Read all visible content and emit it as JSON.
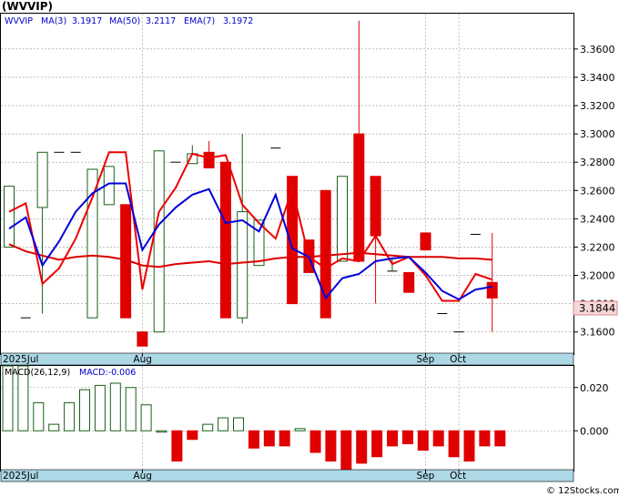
{
  "page_title": "(WVVIP)",
  "footer": "© 12Stocks.com",
  "chart_data": [
    {
      "type": "candlestick",
      "symbol": "WVVIP",
      "legend": [
        {
          "label": "WVVIP",
          "value": "",
          "color": "#0000cc"
        },
        {
          "label": "MA(3)",
          "value": "3.1917",
          "color": "#0000cc"
        },
        {
          "label": "MA(50)",
          "value": "3.2117",
          "color": "#0000cc"
        },
        {
          "label": "EMA(7)",
          "value": "3.1972",
          "color": "#0000cc"
        }
      ],
      "ylim": [
        3.145,
        3.385
      ],
      "y_ticks": [
        "3.1600",
        "3.1800",
        "3.2000",
        "3.2200",
        "3.2400",
        "3.2600",
        "3.2800",
        "3.3000",
        "3.3200",
        "3.3400",
        "3.3600"
      ],
      "x_labels": [
        {
          "label": "2025Jul",
          "index": 0
        },
        {
          "label": "Aug",
          "index": 8
        },
        {
          "label": "Sep",
          "index": 25
        },
        {
          "label": "Oct",
          "index": 27
        }
      ],
      "last_price": "3.1844",
      "up_color": "#1a5e1a",
      "down_color": "#e00000",
      "candles": [
        {
          "o": 3.22,
          "h": 3.263,
          "l": 3.22,
          "c": 3.263
        },
        {
          "o": 3.17,
          "h": 3.17,
          "l": 3.17,
          "c": 3.17
        },
        {
          "o": 3.248,
          "h": 3.287,
          "l": 3.173,
          "c": 3.287
        },
        {
          "o": 3.287,
          "h": 3.287,
          "l": 3.287,
          "c": 3.287
        },
        {
          "o": 3.287,
          "h": 3.287,
          "l": 3.287,
          "c": 3.287
        },
        {
          "o": 3.17,
          "h": 3.275,
          "l": 3.17,
          "c": 3.275
        },
        {
          "o": 3.25,
          "h": 3.277,
          "l": 3.25,
          "c": 3.277
        },
        {
          "o": 3.25,
          "h": 3.25,
          "l": 3.17,
          "c": 3.17
        },
        {
          "o": 3.16,
          "h": 3.16,
          "l": 3.15,
          "c": 3.15
        },
        {
          "o": 3.16,
          "h": 3.288,
          "l": 3.16,
          "c": 3.288
        },
        {
          "o": 3.28,
          "h": 3.28,
          "l": 3.28,
          "c": 3.28
        },
        {
          "o": 3.279,
          "h": 3.292,
          "l": 3.279,
          "c": 3.286
        },
        {
          "o": 3.287,
          "h": 3.295,
          "l": 3.276,
          "c": 3.276
        },
        {
          "o": 3.28,
          "h": 3.28,
          "l": 3.17,
          "c": 3.17
        },
        {
          "o": 3.17,
          "h": 3.3,
          "l": 3.166,
          "c": 3.245
        },
        {
          "o": 3.207,
          "h": 3.239,
          "l": 3.207,
          "c": 3.239
        },
        {
          "o": 3.29,
          "h": 3.29,
          "l": 3.29,
          "c": 3.29
        },
        {
          "o": 3.27,
          "h": 3.27,
          "l": 3.18,
          "c": 3.18
        },
        {
          "o": 3.225,
          "h": 3.225,
          "l": 3.202,
          "c": 3.202
        },
        {
          "o": 3.26,
          "h": 3.26,
          "l": 3.17,
          "c": 3.17
        },
        {
          "o": 3.21,
          "h": 3.27,
          "l": 3.21,
          "c": 3.27
        },
        {
          "o": 3.3,
          "h": 3.38,
          "l": 3.21,
          "c": 3.21
        },
        {
          "o": 3.27,
          "h": 3.27,
          "l": 3.18,
          "c": 3.228
        },
        {
          "o": 3.203,
          "h": 3.212,
          "l": 3.203,
          "c": 3.203
        },
        {
          "o": 3.202,
          "h": 3.202,
          "l": 3.188,
          "c": 3.188
        },
        {
          "o": 3.23,
          "h": 3.23,
          "l": 3.218,
          "c": 3.218
        },
        {
          "o": 3.173,
          "h": 3.173,
          "l": 3.173,
          "c": 3.173
        },
        {
          "o": 3.16,
          "h": 3.16,
          "l": 3.16,
          "c": 3.16
        },
        {
          "o": 3.229,
          "h": 3.229,
          "l": 3.229,
          "c": 3.229
        },
        {
          "o": 3.195,
          "h": 3.23,
          "l": 3.16,
          "c": 3.184
        }
      ],
      "ma3": {
        "color": "#0000dd",
        "x": [
          0,
          1,
          2,
          3,
          4,
          5,
          6,
          7,
          8,
          9,
          10,
          11,
          12,
          13,
          14,
          15,
          16,
          17,
          18,
          19,
          20,
          21,
          22,
          23,
          24,
          25,
          26,
          27,
          28,
          29
        ],
        "values": [
          3.233,
          3.241,
          3.207,
          3.224,
          3.245,
          3.258,
          3.265,
          3.265,
          3.218,
          3.236,
          3.248,
          3.257,
          3.261,
          3.237,
          3.239,
          3.231,
          3.257,
          3.219,
          3.213,
          3.184,
          3.198,
          3.201,
          3.21,
          3.212,
          3.213,
          3.202,
          3.189,
          3.183,
          3.19,
          3.192
        ]
      },
      "ema7": {
        "color": "#ee0000",
        "x": [
          0,
          1,
          2,
          3,
          4,
          5,
          6,
          7,
          8,
          9,
          10,
          11,
          12,
          13,
          14,
          15,
          16,
          17,
          18,
          19,
          20,
          21,
          22,
          23,
          24,
          25,
          26,
          27,
          28,
          29
        ],
        "values": [
          3.245,
          3.251,
          3.194,
          3.205,
          3.226,
          3.255,
          3.287,
          3.287,
          3.19,
          3.245,
          3.262,
          3.286,
          3.283,
          3.285,
          3.25,
          3.237,
          3.226,
          3.261,
          3.213,
          3.205,
          3.212,
          3.21,
          3.228,
          3.208,
          3.213,
          3.2,
          3.182,
          3.182,
          3.201,
          3.197
        ]
      },
      "ma50": {
        "color": "#dd0000",
        "x": [
          0,
          1,
          2,
          3,
          4,
          5,
          6,
          7,
          8,
          9,
          10,
          11,
          12,
          13,
          14,
          15,
          16,
          17,
          18,
          19,
          20,
          21,
          22,
          23,
          24,
          25,
          26,
          27,
          28,
          29
        ],
        "values": [
          3.222,
          3.217,
          3.214,
          3.211,
          3.213,
          3.214,
          3.213,
          3.211,
          3.207,
          3.206,
          3.208,
          3.209,
          3.21,
          3.208,
          3.209,
          3.21,
          3.212,
          3.213,
          3.213,
          3.214,
          3.215,
          3.216,
          3.215,
          3.214,
          3.213,
          3.213,
          3.213,
          3.212,
          3.212,
          3.211
        ]
      }
    },
    {
      "type": "bar",
      "title": "MACD(26,12,9)",
      "subtitle": "MACD:-0.006",
      "ylim": [
        -0.018,
        0.03
      ],
      "y_ticks": [
        "0.000",
        "0.020"
      ],
      "up_color": "#1a5e1a",
      "down_color": "#e00000",
      "values": [
        0.03,
        0.03,
        0.013,
        0.003,
        0.013,
        0.019,
        0.021,
        0.022,
        0.02,
        0.012,
        0.0,
        -0.014,
        -0.004,
        0.003,
        0.006,
        0.006,
        -0.008,
        -0.007,
        -0.007,
        0.001,
        -0.01,
        -0.014,
        -0.019,
        -0.015,
        -0.012,
        -0.007,
        -0.006,
        -0.009,
        -0.007,
        -0.012,
        -0.014,
        -0.007,
        -0.007
      ]
    }
  ]
}
